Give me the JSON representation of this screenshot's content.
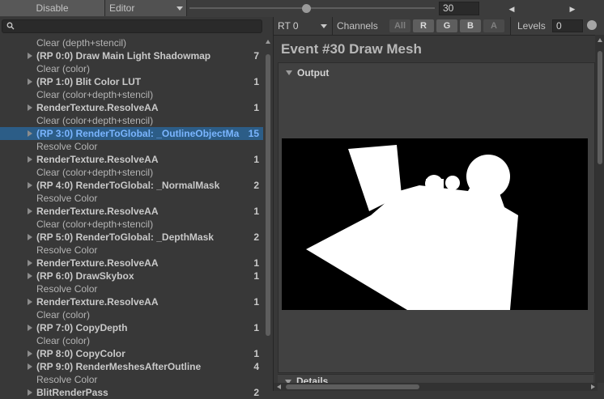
{
  "toolbar": {
    "disable_label": "Disable",
    "editor_label": "Editor",
    "slider_value": 30,
    "event_field": "30",
    "prev_glyph": "◀",
    "next_glyph": "▶"
  },
  "search": {
    "icon": "search-icon",
    "value": ""
  },
  "events": [
    {
      "label": "Clear (depth+stencil)",
      "count": "",
      "group": false,
      "arrow": false
    },
    {
      "label": "(RP 0:0) Draw Main Light Shadowmap",
      "count": "7",
      "group": true,
      "arrow": true
    },
    {
      "label": "Clear (color)",
      "count": "",
      "group": false,
      "arrow": false
    },
    {
      "label": "(RP 1:0) Blit Color LUT",
      "count": "1",
      "group": true,
      "arrow": true
    },
    {
      "label": "Clear (color+depth+stencil)",
      "count": "",
      "group": false,
      "arrow": false
    },
    {
      "label": "RenderTexture.ResolveAA",
      "count": "1",
      "group": true,
      "arrow": true
    },
    {
      "label": "Clear (color+depth+stencil)",
      "count": "",
      "group": false,
      "arrow": false
    },
    {
      "label": "(RP 3:0) RenderToGlobal: _OutlineObjectMa",
      "count": "15",
      "group": true,
      "arrow": true,
      "selected": true
    },
    {
      "label": "Resolve Color",
      "count": "",
      "group": false,
      "arrow": false
    },
    {
      "label": "RenderTexture.ResolveAA",
      "count": "1",
      "group": true,
      "arrow": true
    },
    {
      "label": "Clear (color+depth+stencil)",
      "count": "",
      "group": false,
      "arrow": false
    },
    {
      "label": "(RP 4:0) RenderToGlobal: _NormalMask",
      "count": "2",
      "group": true,
      "arrow": true
    },
    {
      "label": "Resolve Color",
      "count": "",
      "group": false,
      "arrow": false
    },
    {
      "label": "RenderTexture.ResolveAA",
      "count": "1",
      "group": true,
      "arrow": true
    },
    {
      "label": "Clear (color+depth+stencil)",
      "count": "",
      "group": false,
      "arrow": false
    },
    {
      "label": "(RP 5:0) RenderToGlobal: _DepthMask",
      "count": "2",
      "group": true,
      "arrow": true
    },
    {
      "label": "Resolve Color",
      "count": "",
      "group": false,
      "arrow": false
    },
    {
      "label": "RenderTexture.ResolveAA",
      "count": "1",
      "group": true,
      "arrow": true
    },
    {
      "label": "(RP 6:0) DrawSkybox",
      "count": "1",
      "group": true,
      "arrow": true
    },
    {
      "label": "Resolve Color",
      "count": "",
      "group": false,
      "arrow": false
    },
    {
      "label": "RenderTexture.ResolveAA",
      "count": "1",
      "group": true,
      "arrow": true
    },
    {
      "label": "Clear (color)",
      "count": "",
      "group": false,
      "arrow": false
    },
    {
      "label": "(RP 7:0) CopyDepth",
      "count": "1",
      "group": true,
      "arrow": true
    },
    {
      "label": "Clear (color)",
      "count": "",
      "group": false,
      "arrow": false
    },
    {
      "label": "(RP 8:0) CopyColor",
      "count": "1",
      "group": true,
      "arrow": true
    },
    {
      "label": "(RP 9:0) RenderMeshesAfterOutline",
      "count": "4",
      "group": true,
      "arrow": true
    },
    {
      "label": "Resolve Color",
      "count": "",
      "group": false,
      "arrow": false
    },
    {
      "label": "BlitRenderPass",
      "count": "2",
      "group": true,
      "arrow": true
    }
  ],
  "render_target": {
    "rt_label": "RT 0",
    "channels_label": "Channels",
    "channels": [
      "All",
      "R",
      "G",
      "B",
      "A"
    ],
    "levels_label": "Levels",
    "levels_value": "0"
  },
  "event_title": "Event #30 Draw Mesh",
  "output": {
    "header": "Output"
  },
  "details": {
    "header": "Details"
  }
}
